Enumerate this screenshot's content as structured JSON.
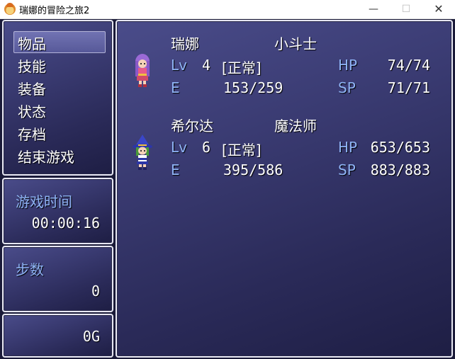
{
  "window": {
    "title": "瑞娜的冒险之旅2",
    "minimize_glyph": "—",
    "maximize_glyph": "☐",
    "close_glyph": "✕"
  },
  "menu": {
    "items": [
      "物品",
      "技能",
      "装备",
      "状态",
      "存档",
      "结束游戏"
    ],
    "selected_index": 0
  },
  "playtime": {
    "label": "游戏时间",
    "value": "00:00:16"
  },
  "steps": {
    "label": "步数",
    "value": "0"
  },
  "gold": {
    "value": "0G"
  },
  "party": [
    {
      "name": "瑞娜",
      "class": "小斗士",
      "lv_label": "Lv",
      "level": "4",
      "state": "[正常]",
      "exp_label": "E",
      "exp": "153/259",
      "hp_label": "HP",
      "hp": "74/74",
      "sp_label": "SP",
      "sp": "71/71",
      "sprite": "purple-haired-girl-sprite"
    },
    {
      "name": "希尔达",
      "class": "魔法师",
      "lv_label": "Lv",
      "level": "6",
      "state": "[正常]",
      "exp_label": "E",
      "exp": "395/586",
      "hp_label": "HP",
      "hp": "653/653",
      "sp_label": "SP",
      "sp": "883/883",
      "sprite": "witch-hat-mage-sprite"
    }
  ],
  "colors": {
    "system_text": "#8fb4f6",
    "window_bg": "#3a3b72",
    "border": "#e8e8f4"
  }
}
